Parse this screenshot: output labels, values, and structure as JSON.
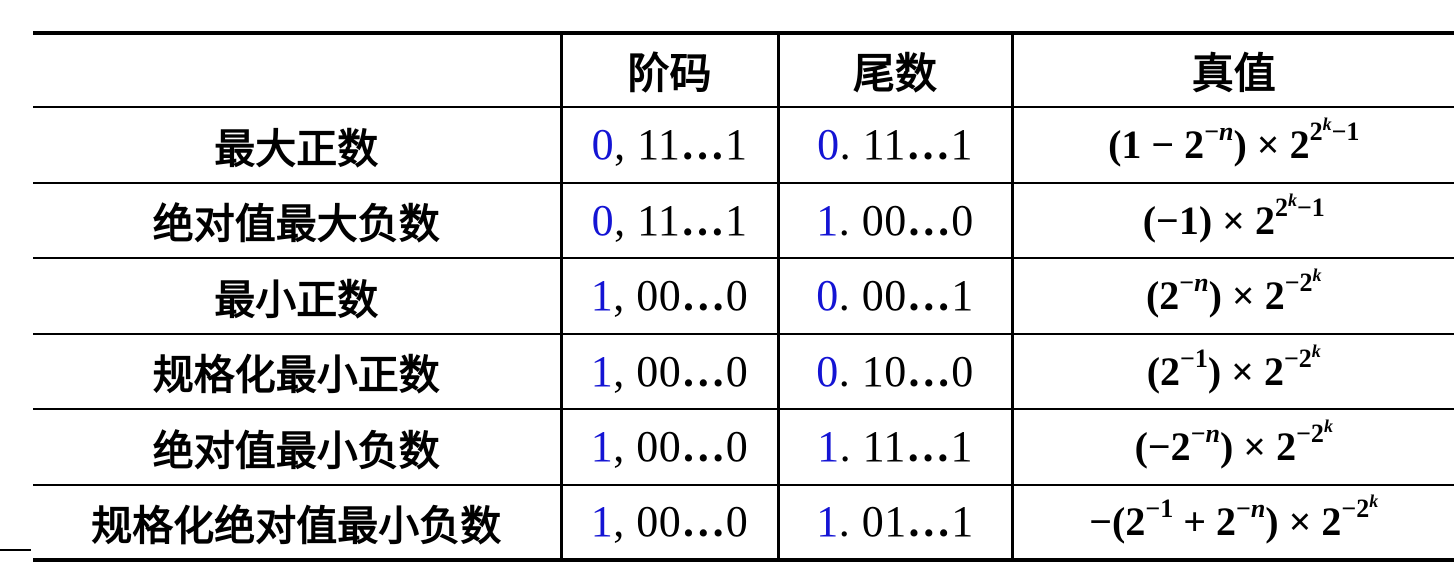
{
  "table": {
    "headers": [
      "",
      "阶码",
      "尾数",
      "真值"
    ],
    "rows": [
      {
        "name": "最大正数",
        "exponent": {
          "sign": "0",
          "sep": ", ",
          "digits": "11",
          "ellipsis": "…",
          "last": "1"
        },
        "mantissa": {
          "sign": "0",
          "sep": ". ",
          "digits": "11",
          "ellipsis": "…",
          "last": "1"
        },
        "value": "(1 − 2^(−n)) × 2^(2^k − 1)"
      },
      {
        "name": "绝对值最大负数",
        "exponent": {
          "sign": "0",
          "sep": ", ",
          "digits": "11",
          "ellipsis": "…",
          "last": "1"
        },
        "mantissa": {
          "sign": "1",
          "sep": ". ",
          "digits": "00",
          "ellipsis": "…",
          "last": "0"
        },
        "value": "(−1) × 2^(2^k − 1)"
      },
      {
        "name": "最小正数",
        "exponent": {
          "sign": "1",
          "sep": ", ",
          "digits": "00",
          "ellipsis": "…",
          "last": "0"
        },
        "mantissa": {
          "sign": "0",
          "sep": ". ",
          "digits": "00",
          "ellipsis": "…",
          "last": "1"
        },
        "value": "(2^(−n)) × 2^(−2^k)"
      },
      {
        "name": "规格化最小正数",
        "exponent": {
          "sign": "1",
          "sep": ", ",
          "digits": "00",
          "ellipsis": "…",
          "last": "0"
        },
        "mantissa": {
          "sign": "0",
          "sep": ". ",
          "digits": "10",
          "ellipsis": "…",
          "last": "0"
        },
        "value": "(2^(−1)) × 2^(−2^k)"
      },
      {
        "name": "绝对值最小负数",
        "exponent": {
          "sign": "1",
          "sep": ", ",
          "digits": "00",
          "ellipsis": "…",
          "last": "0"
        },
        "mantissa": {
          "sign": "1",
          "sep": ". ",
          "digits": "11",
          "ellipsis": "…",
          "last": "1"
        },
        "value": "(−2^(−n)) × 2^(−2^k)"
      },
      {
        "name": "规格化绝对值最小负数",
        "exponent": {
          "sign": "1",
          "sep": ", ",
          "digits": "00",
          "ellipsis": "…",
          "last": "0"
        },
        "mantissa": {
          "sign": "1",
          "sep": ". ",
          "digits": "01",
          "ellipsis": "…",
          "last": "1"
        },
        "value": "−(2^(−1) + 2^(−n)) × 2^(−2^k)"
      }
    ]
  },
  "colors": {
    "sign_bit": "#1414d4",
    "text": "#000000",
    "rule": "#000000"
  }
}
